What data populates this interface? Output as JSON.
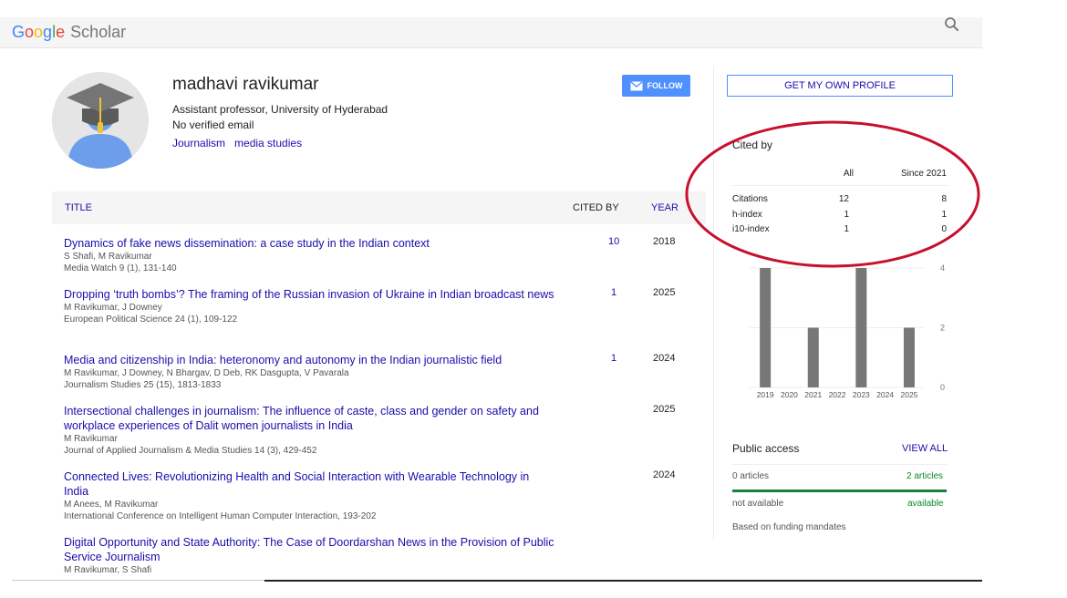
{
  "header": {
    "logo": {
      "letters": [
        "G",
        "o",
        "o",
        "g",
        "l",
        "e"
      ],
      "product": "Scholar"
    },
    "search_icon": "search-icon"
  },
  "profile": {
    "name": "madhavi ravikumar",
    "affiliation": "Assistant professor, University of Hyderabad",
    "email": "No verified email",
    "interests": [
      "Journalism",
      "media studies"
    ],
    "follow_label": "FOLLOW",
    "follow_icon": "envelope-icon"
  },
  "table": {
    "headers": {
      "title": "TITLE",
      "cited_by": "CITED BY",
      "year": "YEAR"
    },
    "articles": [
      {
        "title": "Dynamics of fake news dissemination: a case study in the Indian context",
        "authors": "S Shafi, M Ravikumar",
        "venue": "Media Watch 9 (1), 131-140",
        "cited_by": "10",
        "year": "2018"
      },
      {
        "title": "Dropping ‘truth bombs’? The framing of the Russian invasion of Ukraine in Indian broadcast news",
        "authors": "M Ravikumar, J Downey",
        "venue": "European Political Science 24 (1), 109-122",
        "cited_by": "1",
        "year": "2025"
      },
      {
        "title": "Media and citizenship in India: heteronomy and autonomy in the Indian journalistic field",
        "authors": "M Ravikumar, J Downey, N Bhargav, D Deb, RK Dasgupta, V Pavarala",
        "venue": "Journalism Studies 25 (15), 1813-1833",
        "cited_by": "1",
        "year": "2024"
      },
      {
        "title": "Intersectional challenges in journalism: The influence of caste, class and gender on safety and workplace experiences of Dalit women journalists in India",
        "authors": "M Ravikumar",
        "venue": "Journal of Applied Journalism & Media Studies 14 (3), 429-452",
        "cited_by": "",
        "year": "2025"
      },
      {
        "title": "Connected Lives: Revolutionizing Health and Social Interaction with Wearable Technology in India",
        "authors": "M Anees, M Ravikumar",
        "venue": "International Conference on Intelligent Human Computer Interaction, 193-202",
        "cited_by": "",
        "year": "2024"
      },
      {
        "title": "Digital Opportunity and State Authority: The Case of Doordarshan News in the Provision of Public Service Journalism",
        "authors": "M Ravikumar, S Shafi",
        "venue": "",
        "cited_by": "",
        "year": ""
      }
    ]
  },
  "sidebar": {
    "own_profile_label": "GET MY OWN PROFILE",
    "cited_by": {
      "title": "Cited by",
      "col_all": "All",
      "col_since": "Since 2021",
      "rows": [
        {
          "label": "Citations",
          "all": "12",
          "since": "8"
        },
        {
          "label": "h-index",
          "all": "1",
          "since": "1"
        },
        {
          "label": "i10-index",
          "all": "1",
          "since": "0"
        }
      ]
    },
    "public_access": {
      "title": "Public access",
      "view_all": "VIEW ALL",
      "not_available_count": "0 articles",
      "available_count": "2 articles",
      "not_available_label": "not available",
      "available_label": "available",
      "available_fraction": 1.0,
      "note": "Based on funding mandates",
      "bar_color": "#188038"
    }
  },
  "chart_data": {
    "type": "bar",
    "categories": [
      "2019",
      "2020",
      "2021",
      "2022",
      "2023",
      "2024",
      "2025"
    ],
    "values": [
      4,
      0,
      2,
      0,
      4,
      0,
      2
    ],
    "ylim": [
      0,
      4
    ],
    "yticks": [
      "4",
      "2",
      "0"
    ],
    "bar_color": "#777777",
    "grid": true
  },
  "annotation": {
    "color": "#c8102e",
    "shape": "ellipse"
  }
}
